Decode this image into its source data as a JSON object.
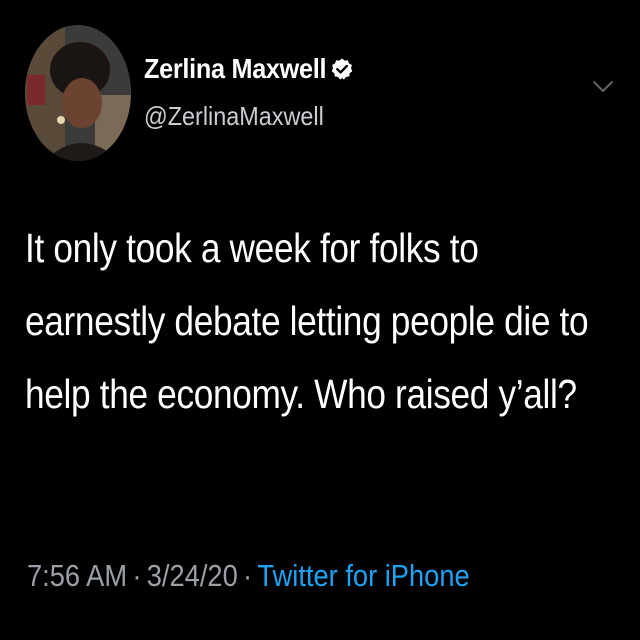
{
  "tweet": {
    "author": {
      "display_name": "Zerlina Maxwell",
      "handle": "@ZerlinaMaxwell",
      "verified": true
    },
    "text": "It only took a week for folks to earnestly debate letting people die to help the economy. Who raised y’all?",
    "time": "7:56 AM",
    "separator": "·",
    "date": "3/24/20",
    "source": "Twitter for iPhone"
  },
  "colors": {
    "background": "#000000",
    "text": "#ffffff",
    "secondary": "#9aa0a6",
    "accent": "#1da1f2"
  },
  "icons": {
    "verified": "verified-badge-icon",
    "more": "chevron-down-icon"
  }
}
